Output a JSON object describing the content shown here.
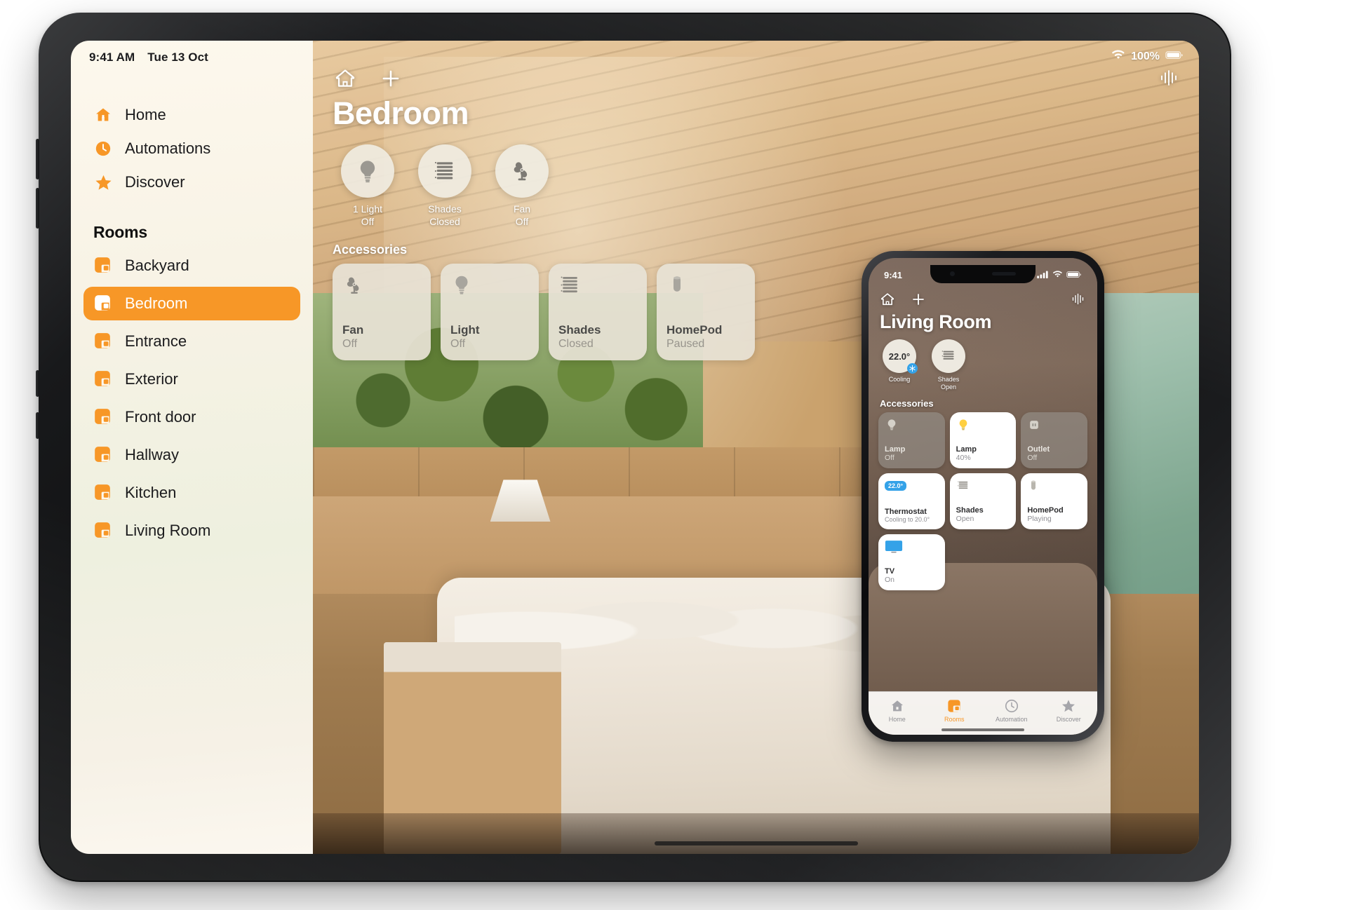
{
  "ipad": {
    "status_bar": {
      "time": "9:41 AM",
      "date": "Tue 13 Oct",
      "battery_percent": "100%",
      "wifi_icon": "wifi-icon",
      "battery_icon": "battery-icon"
    },
    "sidebar": {
      "nav": [
        {
          "label": "Home",
          "icon": "home-icon"
        },
        {
          "label": "Automations",
          "icon": "clock-icon"
        },
        {
          "label": "Discover",
          "icon": "star-icon"
        }
      ],
      "section_title": "Rooms",
      "rooms": [
        {
          "label": "Backyard",
          "icon": "room-icon",
          "selected": false
        },
        {
          "label": "Bedroom",
          "icon": "room-icon",
          "selected": true
        },
        {
          "label": "Entrance",
          "icon": "room-icon",
          "selected": false
        },
        {
          "label": "Exterior",
          "icon": "room-icon",
          "selected": false
        },
        {
          "label": "Front door",
          "icon": "room-icon",
          "selected": false
        },
        {
          "label": "Hallway",
          "icon": "room-icon",
          "selected": false
        },
        {
          "label": "Kitchen",
          "icon": "room-icon",
          "selected": false
        },
        {
          "label": "Living Room",
          "icon": "room-icon",
          "selected": false
        }
      ]
    },
    "main": {
      "home_icon": "home-outline-icon",
      "add_icon": "plus-icon",
      "siri_icon": "siri-waveform-icon",
      "room_title": "Bedroom",
      "status_circles": [
        {
          "name": "1 Light",
          "state": "Off",
          "icon": "lightbulb-icon"
        },
        {
          "name": "Shades",
          "state": "Closed",
          "icon": "blinds-icon"
        },
        {
          "name": "Fan",
          "state": "Off",
          "icon": "fan-icon"
        }
      ],
      "accessories_header": "Accessories",
      "accessories": [
        {
          "name": "Fan",
          "state": "Off",
          "icon": "fan-icon"
        },
        {
          "name": "Light",
          "state": "Off",
          "icon": "lightbulb-icon"
        },
        {
          "name": "Shades",
          "state": "Closed",
          "icon": "blinds-icon"
        },
        {
          "name": "HomePod",
          "state": "Paused",
          "icon": "homepod-icon"
        }
      ]
    }
  },
  "iphone": {
    "status_bar": {
      "time": "9:41",
      "signal_icon": "cellular-icon",
      "wifi_icon": "wifi-icon",
      "battery_icon": "battery-icon"
    },
    "nav": {
      "home_icon": "home-outline-icon",
      "add_icon": "plus-icon",
      "siri_icon": "siri-waveform-icon"
    },
    "room_title": "Living Room",
    "status_circles": [
      {
        "name": "",
        "value": "22.0°",
        "state": "Cooling",
        "icon": "thermostat-icon"
      },
      {
        "name": "Shades",
        "value": "",
        "state": "Open",
        "icon": "blinds-icon"
      }
    ],
    "accessories_header": "Accessories",
    "accessories": [
      {
        "name": "Lamp",
        "state": "Off",
        "icon": "lightbulb-icon",
        "on": false
      },
      {
        "name": "Lamp",
        "state": "40%",
        "icon": "lightbulb-on-icon",
        "on": true
      },
      {
        "name": "Outlet",
        "state": "Off",
        "icon": "outlet-icon",
        "on": false
      },
      {
        "name": "Thermostat",
        "state": "Cooling to 20.0°",
        "icon": "thermostat-badge-icon",
        "badge": "22.0°",
        "on": true
      },
      {
        "name": "Shades",
        "state": "Open",
        "icon": "blinds-icon",
        "on": true
      },
      {
        "name": "HomePod",
        "state": "Playing",
        "icon": "homepod-icon",
        "on": true
      },
      {
        "name": "TV",
        "state": "On",
        "icon": "tv-icon",
        "on": true
      }
    ],
    "tabs": [
      {
        "label": "Home",
        "icon": "home-icon",
        "active": false
      },
      {
        "label": "Rooms",
        "icon": "rooms-icon",
        "active": true
      },
      {
        "label": "Automation",
        "icon": "clock-icon",
        "active": false
      },
      {
        "label": "Discover",
        "icon": "star-icon",
        "active": false
      }
    ]
  },
  "colors": {
    "accent": "#f79727",
    "tile_bg": "#e7e2d5",
    "sidebar_bg": "#f8f3e6"
  }
}
